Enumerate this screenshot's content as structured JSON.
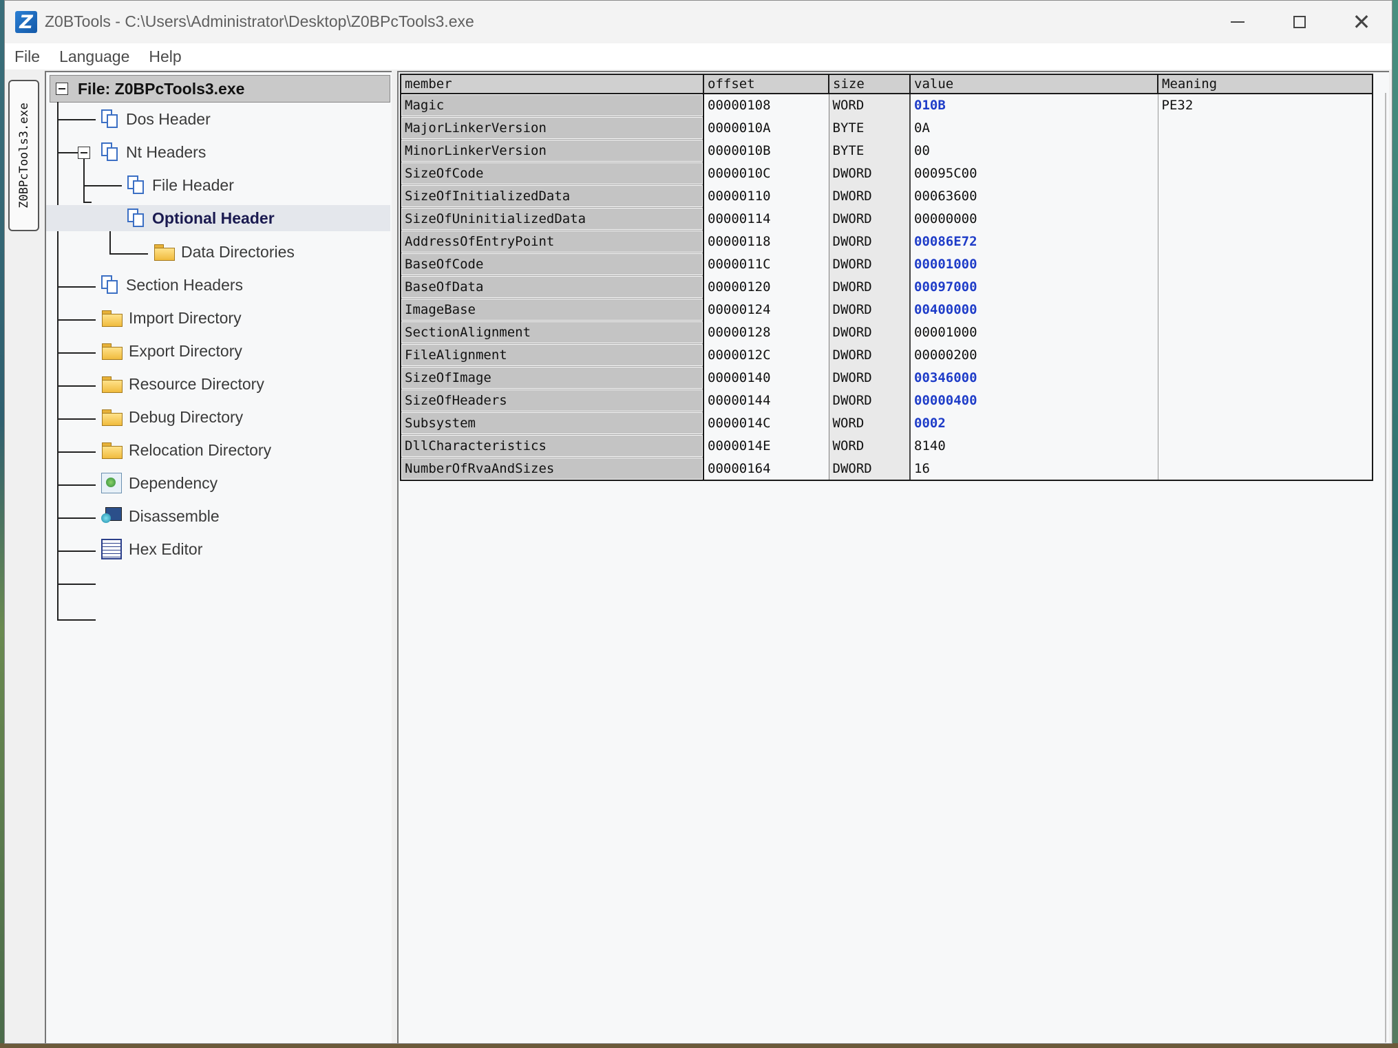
{
  "window": {
    "app_icon_letter": "Z",
    "title": "Z0BTools - C:\\Users\\Administrator\\Desktop\\Z0BPcTools3.exe",
    "minimize_icon": "minimize-icon",
    "maximize_icon": "maximize-icon",
    "close_icon": "close-icon",
    "close_glyph": "✕"
  },
  "menu": {
    "items": [
      "File",
      "Language",
      "Help"
    ]
  },
  "side_tab": {
    "label": "Z0BPcTools3.exe"
  },
  "tree": {
    "root_label": "File: Z0BPcTools3.exe",
    "nodes": [
      {
        "label": "Dos Header",
        "icon": "document-icon"
      },
      {
        "label": "Nt Headers",
        "icon": "document-icon",
        "expanded": true
      },
      {
        "label": "File Header",
        "icon": "document-icon"
      },
      {
        "label": "Optional Header",
        "icon": "document-icon",
        "expanded": true,
        "selected": true
      },
      {
        "label": "Data Directories",
        "icon": "folder-icon"
      },
      {
        "label": "Section Headers",
        "icon": "document-icon"
      },
      {
        "label": "Import Directory",
        "icon": "folder-icon"
      },
      {
        "label": "Export Directory",
        "icon": "folder-icon"
      },
      {
        "label": "Resource Directory",
        "icon": "folder-icon"
      },
      {
        "label": "Debug Directory",
        "icon": "folder-icon"
      },
      {
        "label": "Relocation Directory",
        "icon": "folder-icon"
      },
      {
        "label": "Dependency",
        "icon": "dependency-icon"
      },
      {
        "label": "Disassemble",
        "icon": "disassemble-icon"
      },
      {
        "label": "Hex Editor",
        "icon": "hex-editor-icon"
      }
    ]
  },
  "grid": {
    "columns": [
      "member",
      "offset",
      "size",
      "value",
      "Meaning"
    ],
    "rows": [
      {
        "member": "Magic",
        "offset": "00000108",
        "size": "WORD",
        "value": "010B",
        "meaning": "PE32",
        "highlight": true
      },
      {
        "member": "MajorLinkerVersion",
        "offset": "0000010A",
        "size": "BYTE",
        "value": "0A",
        "meaning": "",
        "highlight": false
      },
      {
        "member": "MinorLinkerVersion",
        "offset": "0000010B",
        "size": "BYTE",
        "value": "00",
        "meaning": "",
        "highlight": false
      },
      {
        "member": "SizeOfCode",
        "offset": "0000010C",
        "size": "DWORD",
        "value": "00095C00",
        "meaning": "",
        "highlight": false
      },
      {
        "member": "SizeOfInitializedData",
        "offset": "00000110",
        "size": "DWORD",
        "value": "00063600",
        "meaning": "",
        "highlight": false
      },
      {
        "member": "SizeOfUninitializedData",
        "offset": "00000114",
        "size": "DWORD",
        "value": "00000000",
        "meaning": "",
        "highlight": false
      },
      {
        "member": "AddressOfEntryPoint",
        "offset": "00000118",
        "size": "DWORD",
        "value": "00086E72",
        "meaning": "",
        "highlight": true
      },
      {
        "member": "BaseOfCode",
        "offset": "0000011C",
        "size": "DWORD",
        "value": "00001000",
        "meaning": "",
        "highlight": true
      },
      {
        "member": "BaseOfData",
        "offset": "00000120",
        "size": "DWORD",
        "value": "00097000",
        "meaning": "",
        "highlight": true
      },
      {
        "member": "ImageBase",
        "offset": "00000124",
        "size": "DWORD",
        "value": "00400000",
        "meaning": "",
        "highlight": true
      },
      {
        "member": "SectionAlignment",
        "offset": "00000128",
        "size": "DWORD",
        "value": "00001000",
        "meaning": "",
        "highlight": false
      },
      {
        "member": "FileAlignment",
        "offset": "0000012C",
        "size": "DWORD",
        "value": "00000200",
        "meaning": "",
        "highlight": false
      },
      {
        "member": "SizeOfImage",
        "offset": "00000140",
        "size": "DWORD",
        "value": "00346000",
        "meaning": "",
        "highlight": true
      },
      {
        "member": "SizeOfHeaders",
        "offset": "00000144",
        "size": "DWORD",
        "value": "00000400",
        "meaning": "",
        "highlight": true
      },
      {
        "member": "Subsystem",
        "offset": "0000014C",
        "size": "WORD",
        "value": "0002",
        "meaning": "",
        "highlight": true
      },
      {
        "member": "DllCharacteristics",
        "offset": "0000014E",
        "size": "WORD",
        "value": "8140",
        "meaning": "",
        "highlight": false
      },
      {
        "member": "NumberOfRvaAndSizes",
        "offset": "00000164",
        "size": "DWORD",
        "value": "16",
        "meaning": "",
        "highlight": false
      }
    ]
  },
  "colors": {
    "highlight_value": "#1e3cc8",
    "member_cell": "#c4c4c4",
    "selected_node": "#e4e7ec"
  }
}
